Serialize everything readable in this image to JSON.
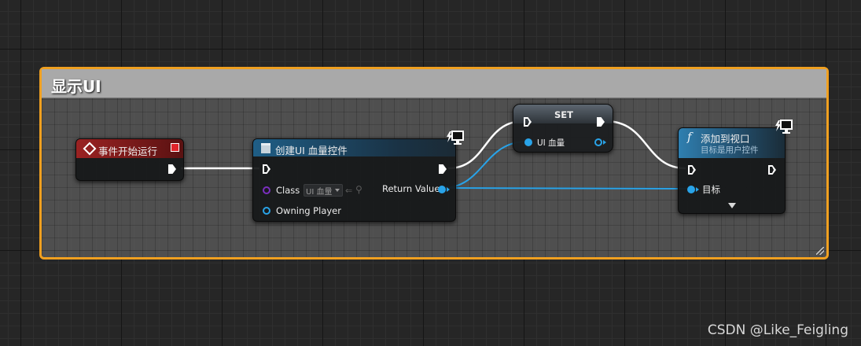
{
  "comment": {
    "title": "显示UI"
  },
  "event_node": {
    "title": "事件开始运行"
  },
  "create_node": {
    "title": "创建UI 血量控件",
    "class_label": "Class",
    "class_value": "UI 血量",
    "owning_player_label": "Owning Player",
    "return_label": "Return Value"
  },
  "set_node": {
    "title": "SET",
    "var_label": "UI 血量"
  },
  "add_node": {
    "title": "添加到视口",
    "subtitle": "目标是用户控件",
    "target_label": "目标",
    "func_glyph": "f"
  },
  "watermark": "CSDN @Like_Feigling",
  "colors": {
    "comment_border": "#f0a020",
    "event_header": "#8c1c1c",
    "object_pin": "#29a3e8",
    "class_pin": "#7b2fc0"
  },
  "icons": [
    "event-diamond-icon",
    "delegate-square-icon",
    "widget-icon",
    "function-f-icon",
    "network-monitor-icon",
    "expand-arrow-icon",
    "use-selected-icon",
    "browse-icon",
    "resize-grip-icon"
  ]
}
